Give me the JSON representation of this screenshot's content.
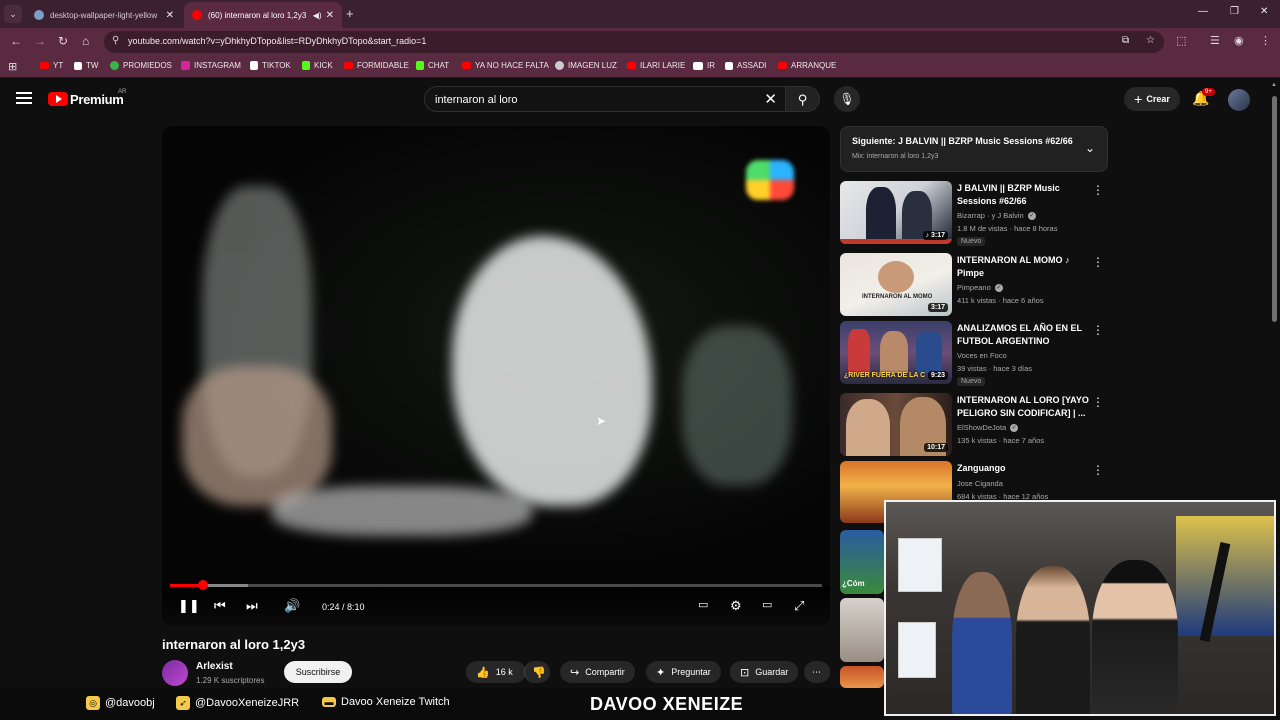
{
  "browser": {
    "tabs": [
      {
        "title": "desktop-wallpaper-light-yellow",
        "active": false,
        "favicon_color": "#7aa0c8"
      },
      {
        "title": "(60) internaron al loro 1,2y3",
        "active": true,
        "favicon_color": "#ff0000"
      }
    ],
    "url": "youtube.com/watch?v=yDhkhyDTopo&list=RDyDhkhyDTopo&start_radio=1",
    "bookmarks": [
      {
        "label": "YT",
        "color": "#ff0000"
      },
      {
        "label": "TW",
        "color": "#ffffff"
      },
      {
        "label": "PROMIEDOS",
        "color": "#3cb34a"
      },
      {
        "label": "INSTAGRAM",
        "color": "#d6249f"
      },
      {
        "label": "TIKTOK",
        "color": "#ffffff"
      },
      {
        "label": "KICK",
        "color": "#53fc18"
      },
      {
        "label": "FORMIDABLE",
        "color": "#ff0000"
      },
      {
        "label": "CHAT",
        "color": "#53fc18"
      },
      {
        "label": "YA NO HACE FALTA",
        "color": "#ff0000"
      },
      {
        "label": "IMAGEN LUZ",
        "color": "#cccccc"
      },
      {
        "label": "ILARI LARIE",
        "color": "#ff0000"
      },
      {
        "label": "IR",
        "color": "#ffffff"
      },
      {
        "label": "ASSADI",
        "color": "#ffffff"
      },
      {
        "label": "ARRANQUE",
        "color": "#ff0000"
      }
    ]
  },
  "yt": {
    "brand": "Premium",
    "region": "AR",
    "search_query": "internaron al loro",
    "create_label": "Crear",
    "notif_count": "9+",
    "accent": "#ff0000"
  },
  "video": {
    "title": "internaron al loro 1,2y3",
    "time": "0:24 / 8:10",
    "progress_played": 0.05,
    "progress_buffered": 0.12,
    "channel": "Arlexist",
    "subscribers": "1.29 K suscriptores",
    "subscribe_label": "Suscribirse",
    "likes": "16 k",
    "share_label": "Compartir",
    "ask_label": "Preguntar",
    "save_label": "Guardar"
  },
  "next_panel": {
    "title": "Siguiente: J BALVIN || BZRP Music Sessions #62/66",
    "subtitle": "Mix: internaron al loro 1,2y3"
  },
  "recommendations": [
    {
      "title": "J BALVIN || BZRP Music Sessions #62/66",
      "channel": "Bizarrap · y J Balvin",
      "meta": "1.8 M de vistas · hace 8 horas",
      "badge": "Nuevo",
      "duration": "3:17",
      "thumb_label": ""
    },
    {
      "title": "INTERNARON AL MOMO ♪ Pimpe",
      "channel": "Pimpeano",
      "meta": "411 k vistas · hace 6 años",
      "badge": "",
      "duration": "3:17",
      "thumb_label": "INTERNARON AL MOMO"
    },
    {
      "title": "ANALIZAMOS EL AÑO EN EL FUTBOL ARGENTINO ¿QUIENE...",
      "channel": "Voces en Foco",
      "meta": "39 vistas · hace 3 días",
      "badge": "Nuevo",
      "duration": "9:23",
      "thumb_label": "¿RIVER FUERA DE LA C"
    },
    {
      "title": "INTERNARON AL LORO [YAYO PELIGRO SIN CODIFICAR] | ...",
      "channel": "ElShowDeJota",
      "meta": "135 k vistas · hace 7 años",
      "badge": "",
      "duration": "10:17",
      "thumb_label": ""
    },
    {
      "title": "Zanguango",
      "channel": "Jose Ciganda",
      "meta": "684 k vistas · hace 12 años",
      "badge": "",
      "duration": "",
      "thumb_label": ""
    }
  ],
  "side_thumb_labels": [
    "¿Cóm"
  ],
  "footer": {
    "instagram": "@davoobj",
    "twitter": "@DavooXeneizeJRR",
    "twitch": "Davoo Xeneize Twitch",
    "brand": "DAVOO XENEIZE"
  }
}
